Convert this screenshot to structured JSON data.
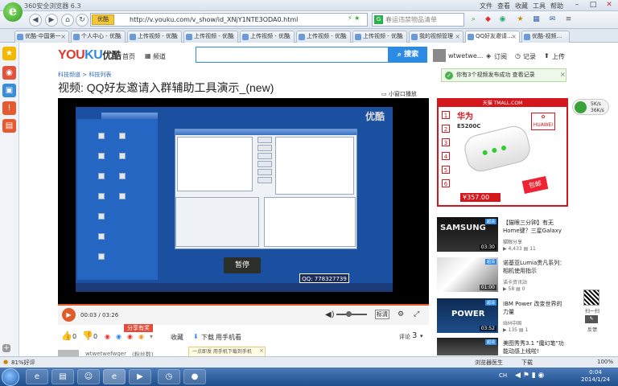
{
  "browser": {
    "title": "360安全浏览器 6.3",
    "menu": [
      "文件",
      "查看",
      "收藏",
      "工具",
      "帮助"
    ],
    "url": "http://v.youku.com/v_show/id_XNjY1NTE3ODA0.html",
    "url_badge": "优酷",
    "search_placeholder": "春运违禁物品清单",
    "tabs": [
      "优酷-中国第一",
      "个人中心 - 优酷",
      "上传视频 - 优酷",
      "上传视频 - 优酷",
      "上传视频 - 优酷",
      "上传视频 - 优酷",
      "上传视频 - 优酷",
      "我的视频管理",
      "QQ好友邀请...",
      "优酷-视频..."
    ],
    "status_left": "81%好评",
    "status_items": [
      "浏览器医生",
      "下载",
      "100%"
    ]
  },
  "youku": {
    "logo": "YOUKU优酷",
    "nav": [
      "首页",
      "频道"
    ],
    "search_button": "搜索",
    "user": "wtwetwe...",
    "header_links": [
      "订阅",
      "记录",
      "上传"
    ],
    "breadcrumb": "科技频道 > 科技列表",
    "video_title": "视频: QQ好友邀请入群辅助工具演示_(new)",
    "mini_window": "小窗口播放",
    "notice": "你有3个视频发布成功 查看记录",
    "pause_label": "暂停",
    "qq_label": "QQ: 778327739",
    "watermark": "优酷",
    "time_current": "00:03",
    "time_total": "03:26",
    "hd_label": "标清",
    "like_count": "0",
    "dislike_count": "0",
    "share_badge": "分享有奖",
    "actions": [
      "收藏",
      "下载",
      "用手机看"
    ],
    "comments": "评论",
    "comment_count": "3",
    "uploader": "wtwetwefwger",
    "uploader_note": "(粉丝数)",
    "tooltip": "一点即发 用手机下载到手机",
    "ad": {
      "header": "天猫 TMALL.COM",
      "brand": "华为",
      "model": "E5200C",
      "price": "¥357.00",
      "badge": "包邮",
      "numbers": [
        "1",
        "2",
        "3",
        "4",
        "5",
        "6"
      ]
    },
    "related": [
      {
        "title": "【猫眼三分钟】有无Home键？三星Galaxy ...",
        "channel": "猫眼分享",
        "plays": "4,433",
        "comments": "11",
        "duration": "03:30",
        "thumb": "SAMSUNG"
      },
      {
        "title": "诺基亚Lumia贵凡系列：相机使用指示",
        "channel": "诺卡资讯站",
        "plays": "58",
        "comments": "0",
        "duration": "01:00",
        "thumb": ""
      },
      {
        "title": "IBM Power 改变世界的力量",
        "channel": "IBM中国",
        "plays": "135",
        "comments": "1",
        "duration": "03:52",
        "thumb": "POWER"
      },
      {
        "title": "美图秀秀3.1 \"魔幻笔\"功能动感上线啦!",
        "channel": "",
        "plays": "",
        "comments": "",
        "duration": "",
        "thumb": ""
      }
    ],
    "float_button": {
      "line1": "5K/s",
      "line2": "36K/s"
    },
    "side_qr_labels": [
      "扫一扫",
      "反馈"
    ]
  },
  "taskbar": {
    "time": "0:04",
    "date": "2014/1/24",
    "lang": "CH"
  }
}
